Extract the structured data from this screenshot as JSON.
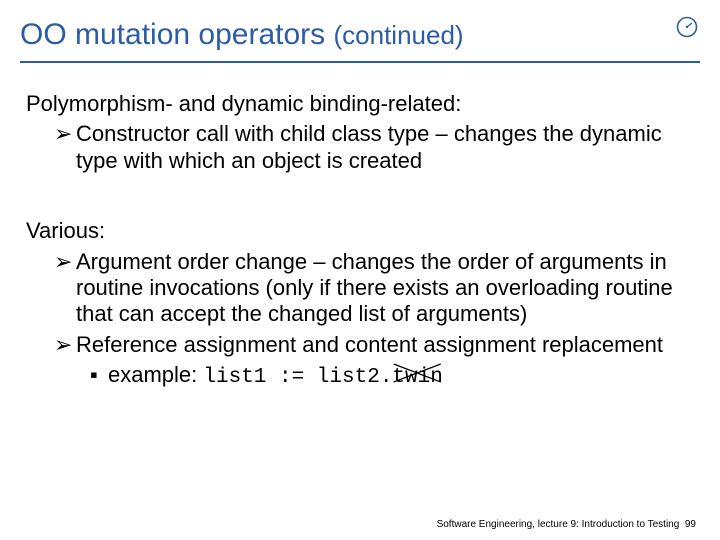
{
  "title": {
    "main": "OO mutation operators ",
    "continued": "(continued)"
  },
  "logo": {
    "name": "clock-logo"
  },
  "sections": [
    {
      "heading": "Polymorphism- and dynamic binding-related:",
      "bullets": [
        {
          "text": "Constructor call with child class type – changes the dynamic type with which an object is created"
        }
      ]
    },
    {
      "heading": "Various:",
      "bullets": [
        {
          "text": "Argument order change – changes the order of arguments in routine invocations (only if there exists an overloading routine that can accept the changed list of arguments)"
        },
        {
          "text": "Reference assignment and content assignment replacement",
          "sub": {
            "label": "example: ",
            "code_plain": "list1 := list2.",
            "code_struck": "twin"
          }
        }
      ]
    }
  ],
  "footer": {
    "text": "Software Engineering, lecture 9: Introduction to Testing",
    "page": "99"
  },
  "marks": {
    "bullet": "➢",
    "subbullet": "▪"
  }
}
